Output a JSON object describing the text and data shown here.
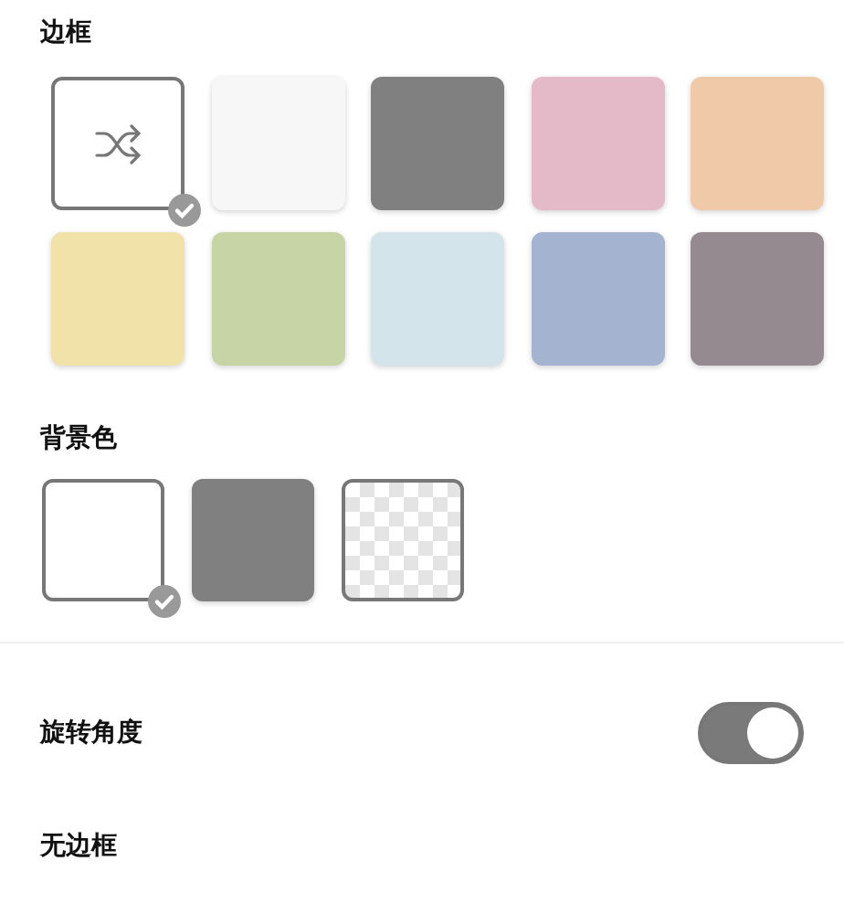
{
  "border": {
    "title": "边框",
    "options": [
      {
        "kind": "shuffle",
        "selected": true
      },
      {
        "kind": "color",
        "color": "#f7f7f7",
        "selected": false
      },
      {
        "kind": "color",
        "color": "#808080",
        "selected": false
      },
      {
        "kind": "color",
        "color": "#e4bac9",
        "selected": false
      },
      {
        "kind": "color",
        "color": "#f0caa8",
        "selected": false
      },
      {
        "kind": "color",
        "color": "#f1e2aa",
        "selected": false
      },
      {
        "kind": "color",
        "color": "#c7d4a6",
        "selected": false
      },
      {
        "kind": "color",
        "color": "#d3e5eb",
        "selected": false
      },
      {
        "kind": "color",
        "color": "#a4b3cf",
        "selected": false
      },
      {
        "kind": "color",
        "color": "#958a90",
        "selected": false
      }
    ]
  },
  "background": {
    "title": "背景色",
    "options": [
      {
        "kind": "color",
        "color": "#ffffff",
        "selected": true
      },
      {
        "kind": "color",
        "color": "#808080",
        "selected": false
      },
      {
        "kind": "transparent",
        "selected": false
      }
    ]
  },
  "settings": [
    {
      "kind": "toggle",
      "label": "旋转角度",
      "on": true
    },
    {
      "kind": "plain",
      "label": "无边框"
    }
  ]
}
